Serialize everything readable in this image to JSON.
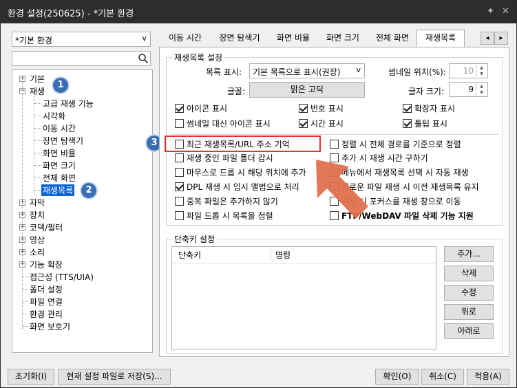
{
  "window": {
    "title": "환경 설정(250625) - *기본 환경",
    "pin_icon": "pin-icon",
    "close_icon": "close-icon"
  },
  "preset_combo": {
    "value": "*기본 환경"
  },
  "search": {
    "placeholder": "",
    "icon": "search-icon"
  },
  "tree": {
    "items": [
      {
        "label": "기본",
        "expander": "+"
      },
      {
        "label": "재생",
        "expander": "−"
      },
      {
        "label": "고급 재생 기능"
      },
      {
        "label": "시각화"
      },
      {
        "label": "이동 시간"
      },
      {
        "label": "장면 탐색기"
      },
      {
        "label": "화면 비율"
      },
      {
        "label": "화면 크기"
      },
      {
        "label": "전체 화면"
      },
      {
        "label": "재생목록",
        "selected": true
      },
      {
        "label": "자막",
        "expander": "+"
      },
      {
        "label": "장치",
        "expander": "+"
      },
      {
        "label": "코덱/필터",
        "expander": "+"
      },
      {
        "label": "영상",
        "expander": "+"
      },
      {
        "label": "소리",
        "expander": "+"
      },
      {
        "label": "기능 확장",
        "expander": "+"
      },
      {
        "label": "접근성 (TTS/UIA)"
      },
      {
        "label": "폴더 설정"
      },
      {
        "label": "파일 연결"
      },
      {
        "label": "환경 관리"
      },
      {
        "label": "화면 보호기"
      }
    ]
  },
  "badges": [
    "1",
    "2",
    "3"
  ],
  "tabs": [
    "이동 시간",
    "장면 탐색기",
    "화면 비율",
    "화면 크기",
    "전체 화면",
    "재생목록"
  ],
  "tab_scroll": {
    "left": "◂",
    "right": "▸"
  },
  "playlist_group": {
    "title": "재생목록 설정",
    "list_display_label": "목록 표시:",
    "list_display_value": "기본 목록으로 표시(권장)",
    "thumb_pos_label": "썸네일 위치(%):",
    "thumb_pos_value": "10",
    "font_label": "글꼴:",
    "font_button": "맑은 고딕",
    "font_size_label": "글자 크기:",
    "font_size_value": "9"
  },
  "checks_top": [
    {
      "label": "아이콘 표시",
      "checked": true
    },
    {
      "label": "번호 표시",
      "checked": true
    },
    {
      "label": "확장자 표시",
      "checked": true
    },
    {
      "label": "썸네일 대신 아이콘 표시",
      "checked": false
    },
    {
      "label": "시간 표시",
      "checked": true
    },
    {
      "label": "툴팁 표시",
      "checked": true
    }
  ],
  "checks_left": [
    {
      "label": "최근 재생목록/URL 주소 기억",
      "checked": false
    },
    {
      "label": "재생 중인 파일 폴더 감시",
      "checked": false
    },
    {
      "label": "마우스로 드롭 시 해당 위치에 추가",
      "checked": false
    },
    {
      "label": "DPL 재생 시 임시 앨범으로 처리",
      "checked": true
    },
    {
      "label": "중복 파일은 추가하지 않기",
      "checked": false
    },
    {
      "label": "파일 드롭 시 목록을 정렬",
      "checked": false
    }
  ],
  "checks_right": [
    {
      "label": "정렬 시 전체 경로를 기준으로 정렬",
      "checked": false
    },
    {
      "label": "추가 시 재생 시간 구하기",
      "checked": false
    },
    {
      "label": "메뉴에서 재생목록 선택 시 자동 재생",
      "checked": false
    },
    {
      "label": "새로운 파일 재생 시 이전 재생목록 유지",
      "checked": false
    },
    {
      "label": "시작 시 포커스를 재생 창으로 이동",
      "checked": false
    },
    {
      "label": "FTP/WebDAV 파일 삭제 기능 지원",
      "checked": false,
      "bold": true
    }
  ],
  "shortcut_group": {
    "title": "단축키 설정",
    "col_shortcut": "단축키",
    "col_command": "명령",
    "buttons": [
      "추가...",
      "삭제",
      "수정",
      "위로",
      "아래로"
    ]
  },
  "footer": {
    "reset": "초기화(I)",
    "save_as": "현재 설정 파일로 저장(S)...",
    "ok": "확인(O)",
    "cancel": "취소(C)",
    "apply": "적용(A)"
  },
  "colors": {
    "titlebar": "#2d2d30",
    "selection": "#0a64d6",
    "badge": "#3b6fb5",
    "highlight": "#e23232",
    "arrow": "#e0704f"
  }
}
